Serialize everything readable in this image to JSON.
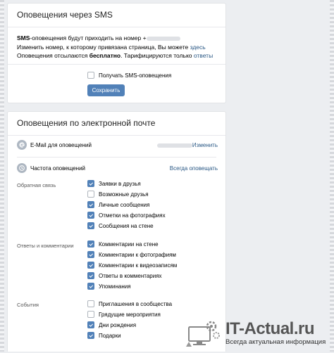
{
  "sms": {
    "title": "Оповещения через SMS",
    "line1_bold": "SMS",
    "line1_rest": "-оповещения будут приходить на номер +",
    "line2_text": "Изменить номер, к которому привязана страница, Вы можете ",
    "line2_link": "здесь",
    "line3_start": "Оповещения отсылаются ",
    "line3_bold": "бесплатно",
    "line3_mid": ". Тарифицируются только ",
    "line3_link": "ответы",
    "checkbox_label": "Получать SMS-оповещения",
    "save_label": "Сохранить"
  },
  "email": {
    "title": "Оповещения по электронной почте",
    "email_label": "E-Mail для оповещений",
    "change_link": "Изменить",
    "freq_label": "Частота оповещений",
    "freq_value": "Всегда оповещать",
    "sections": [
      {
        "label": "Обратная связь",
        "options": [
          {
            "label": "Заявки в друзья",
            "checked": true
          },
          {
            "label": "Возможные друзья",
            "checked": false
          },
          {
            "label": "Личные сообщения",
            "checked": true
          },
          {
            "label": "Отметки на фотографиях",
            "checked": true
          },
          {
            "label": "Сообщения на стене",
            "checked": true
          }
        ]
      },
      {
        "label": "Ответы и комментарии",
        "options": [
          {
            "label": "Комментарии на стене",
            "checked": true
          },
          {
            "label": "Комментарии к фотографиям",
            "checked": true
          },
          {
            "label": "Комментарии к видеозаписям",
            "checked": true
          },
          {
            "label": "Ответы в комментариях",
            "checked": true
          },
          {
            "label": "Упоминания",
            "checked": true
          }
        ]
      },
      {
        "label": "События",
        "options": [
          {
            "label": "Приглашения в сообщества",
            "checked": false
          },
          {
            "label": "Грядущие мероприятия",
            "checked": false
          },
          {
            "label": "Дни рождения",
            "checked": true
          },
          {
            "label": "Подарки",
            "checked": true
          }
        ]
      }
    ]
  },
  "watermark": {
    "title": "IT-Actual.ru",
    "subtitle": "Всегда актуальная информация"
  },
  "colors": {
    "accent": "#5181b8",
    "link": "#2a5885",
    "background": "#eceef1"
  },
  "icons": {
    "email_row": "at-sign-icon",
    "frequency_row": "clock-icon",
    "watermark": "monitor-with-gears-icon"
  }
}
